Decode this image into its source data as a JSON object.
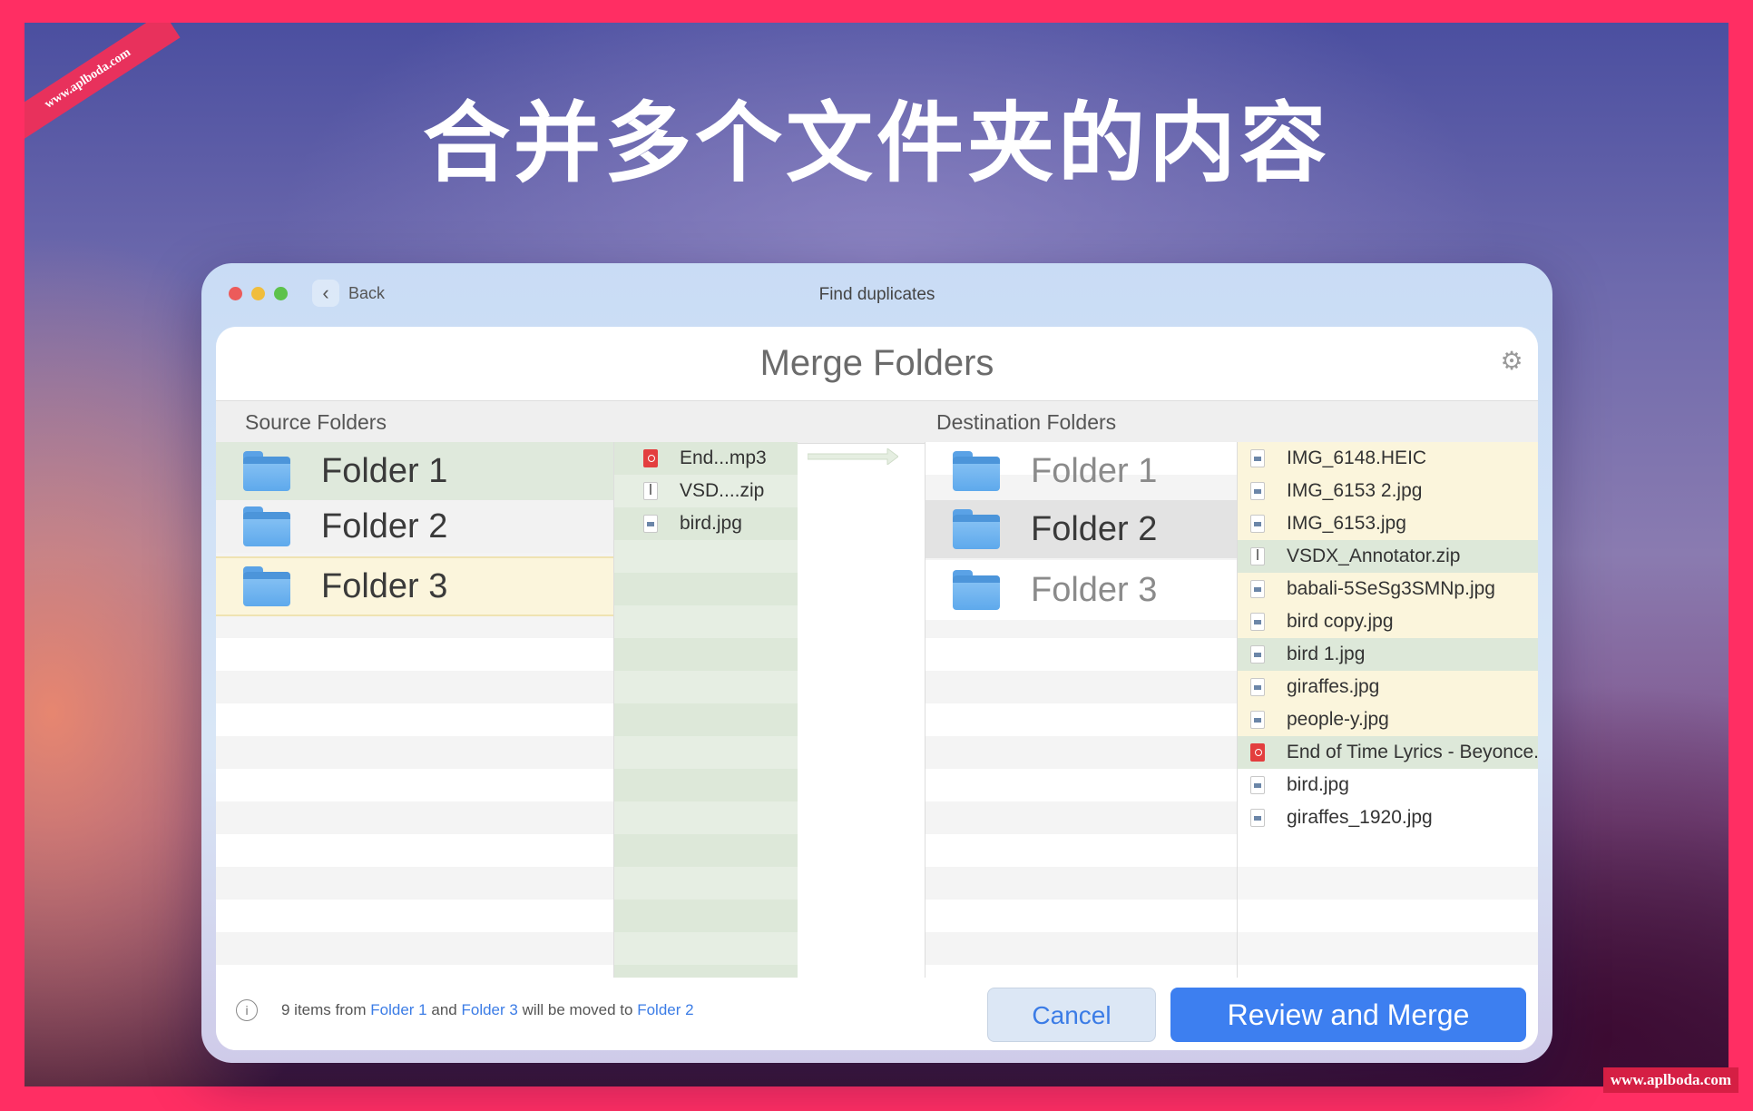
{
  "page": {
    "headline": "合并多个文件夹的内容",
    "watermark_ribbon": "www.aplboda.com",
    "watermark_corner": "www.aplboda.com"
  },
  "window": {
    "back_label": "Back",
    "title": "Find duplicates"
  },
  "panel": {
    "title": "Merge Folders",
    "source_header": "Source Folders",
    "destination_header": "Destination Folders"
  },
  "source_folders": [
    {
      "name": "Folder 1",
      "state": "selected-green"
    },
    {
      "name": "Folder 2",
      "state": "normal"
    },
    {
      "name": "Folder 3",
      "state": "highlight-yellow"
    }
  ],
  "source_files": [
    {
      "name": "End...mp3",
      "type": "mp3"
    },
    {
      "name": "VSD....zip",
      "type": "zip"
    },
    {
      "name": "bird.jpg",
      "type": "img"
    }
  ],
  "destination_folders": [
    {
      "name": "Folder 1",
      "state": "dim"
    },
    {
      "name": "Folder 2",
      "state": "selected"
    },
    {
      "name": "Folder 3",
      "state": "dim"
    }
  ],
  "destination_files": [
    {
      "name": "IMG_6148.HEIC",
      "type": "img",
      "bg": "#fbf5dc"
    },
    {
      "name": "IMG_6153 2.jpg",
      "type": "img",
      "bg": "#fbf5dc"
    },
    {
      "name": "IMG_6153.jpg",
      "type": "img",
      "bg": "#fbf5dc"
    },
    {
      "name": "VSDX_Annotator.zip",
      "type": "zip",
      "bg": "#dde8d9"
    },
    {
      "name": "babali-5SeSg3SMNp.jpg",
      "type": "img",
      "bg": "#fbf5dc"
    },
    {
      "name": "bird copy.jpg",
      "type": "img",
      "bg": "#fbf5dc"
    },
    {
      "name": "bird 1.jpg",
      "type": "img",
      "bg": "#dde8d9"
    },
    {
      "name": "giraffes.jpg",
      "type": "img",
      "bg": "#fbf5dc"
    },
    {
      "name": "people-y.jpg",
      "type": "img",
      "bg": "#fbf5dc"
    },
    {
      "name": "End of Time Lyrics - Beyonce.",
      "type": "mp3",
      "bg": "#dde8d9"
    },
    {
      "name": "bird.jpg",
      "type": "img",
      "bg": "#ffffff"
    },
    {
      "name": "giraffes_1920.jpg",
      "type": "img",
      "bg": "#ffffff"
    }
  ],
  "footer": {
    "info_pre": "9 items from",
    "info_link1": "Folder 1",
    "info_and": "and",
    "info_link2": "Folder 3",
    "info_mid": "will be moved to",
    "info_link3": "Folder 2",
    "cancel_label": "Cancel",
    "merge_label": "Review and Merge"
  },
  "colors": {
    "accent": "#3d7ff0",
    "frame": "#ff2e63",
    "green_highlight": "#dde8d9",
    "yellow_highlight": "#fbf5dc"
  }
}
